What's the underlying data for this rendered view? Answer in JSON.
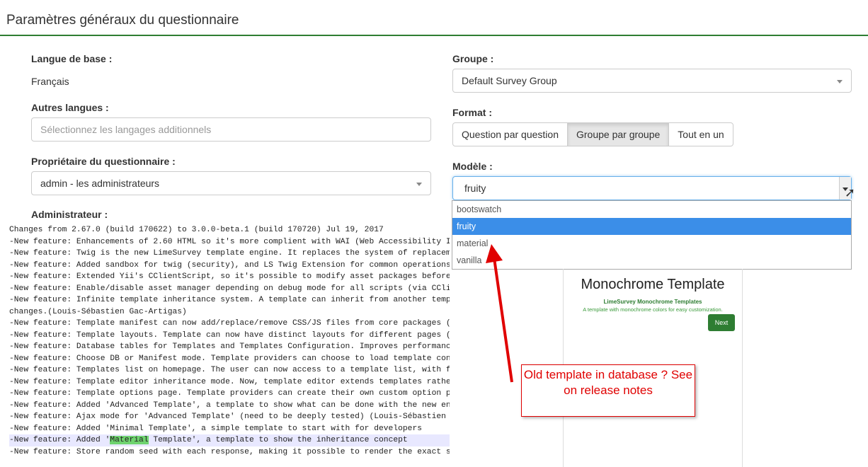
{
  "page_title": "Paramètres généraux du questionnaire",
  "base_language": {
    "label": "Langue de base :",
    "value": "Français"
  },
  "other_languages": {
    "label": "Autres langues :",
    "placeholder": "Sélectionnez les langages additionnels"
  },
  "owner": {
    "label": "Propriétaire du questionnaire :",
    "value": "admin - les administrateurs"
  },
  "administrator": {
    "label": "Administrateur :"
  },
  "group": {
    "label": "Groupe :",
    "value": "Default Survey Group"
  },
  "format": {
    "label": "Format :",
    "options": [
      "Question par question",
      "Groupe par groupe",
      "Tout en un"
    ],
    "selected": "Groupe par groupe"
  },
  "template": {
    "label": "Modèle :",
    "value": "fruity",
    "options": [
      "bootswatch",
      "fruity",
      "material",
      "vanilla"
    ]
  },
  "preview": {
    "title": "Monochrome Template",
    "subtitle": "LimeSurvey Monochrome Templates",
    "description": "A template with monochrome colors for easy customization.",
    "next": "Next"
  },
  "callout": {
    "text": "Old template in database ? See on release notes"
  },
  "changelog": [
    "Changes from 2.67.0 (build 170622) to 3.0.0-beta.1 (build 170720) Jul 19, 2017",
    "-New feature: Enhancements of 2.60 HTML so it's more complient with WAI (Web Accessibility I",
    "-New feature: Twig is the new LimeSurvey template engine. It replaces the system of replacem",
    "-New feature: Added sandbox for twig (security), and LS Twig Extension for common operations",
    "-New feature: Extended Yii's CClientScript, so it's possible to modify asset packages before",
    "-New feature: Enable/disable asset manager depending on debug mode for all scripts (via CCli",
    "-New feature: Infinite template inheritance system. A template can inherit from another temp",
    "changes.(Louis-Sébastien Gac-Artigas)",
    "-New feature: Template manifest can now add/replace/remove CSS/JS files from core packages (",
    "-New feature: Template layouts. Template can now have distinct layouts for different pages (",
    "-New feature: Database tables for Templates and Templates Configuration. Improves performanc",
    "-New feature: Choose DB or Manifest mode. Template providers can choose to load template con",
    "-New feature: Templates list on homepage. The user can now access to a template list, with f",
    "-New feature: Template editor inheritance mode. Now, template editor extends templates rathe",
    "-New feature: Template options page. Template providers can create their own custom option p",
    "-New feature: Added 'Advanced Template', a template to show what can be done with the new en",
    "-New feature: Ajax mode for 'Advanced Template' (need to be deeply tested) (Louis-Sébastien ",
    "-New feature: Added 'Minimal Template', a simple template to start with for developers"
  ],
  "highlight_line": {
    "before": "-New feature: Added '",
    "mark": "Material",
    "after": " Template', a template to show the inheritance concept"
  },
  "last_line": "-New feature: Store random seed with each response, making it possible to render the exact s"
}
